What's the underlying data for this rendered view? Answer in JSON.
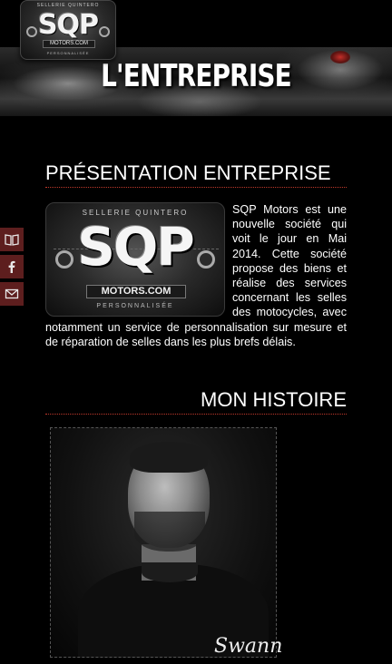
{
  "header": {
    "logo": {
      "top_text": "SELLERIE QUINTERO",
      "main_text": "SQP",
      "sub_text": "MOTORS.COM",
      "bottom_text": "PERSONNALISÉE"
    },
    "menu_icon": "hamburger-icon",
    "accent_color": "#e0312a"
  },
  "banner": {
    "title": "L'ENTREPRISE"
  },
  "social": {
    "items": [
      {
        "name": "book-icon"
      },
      {
        "name": "facebook-icon"
      },
      {
        "name": "mail-icon"
      }
    ],
    "bg_color": "#5d1e1e"
  },
  "presentation": {
    "title": "PRÉSENTATION ENTREPRISE",
    "logo": {
      "top_text": "SELLERIE QUINTERO",
      "main_text": "SQP",
      "sub_text": "MOTORS.COM",
      "bottom_text": "PERSONNALISÉE"
    },
    "text": "SQP Motors est une nouvelle société qui voit le jour en Mai 2014. Cette société propose des biens et réalise des services concernant les selles des motocycles, avec notamment un service de personnalisation sur mesure et de réparation de selles dans les plus brefs délais."
  },
  "histoire": {
    "title": "MON HISTOIRE",
    "photo_signature": "Swann"
  }
}
